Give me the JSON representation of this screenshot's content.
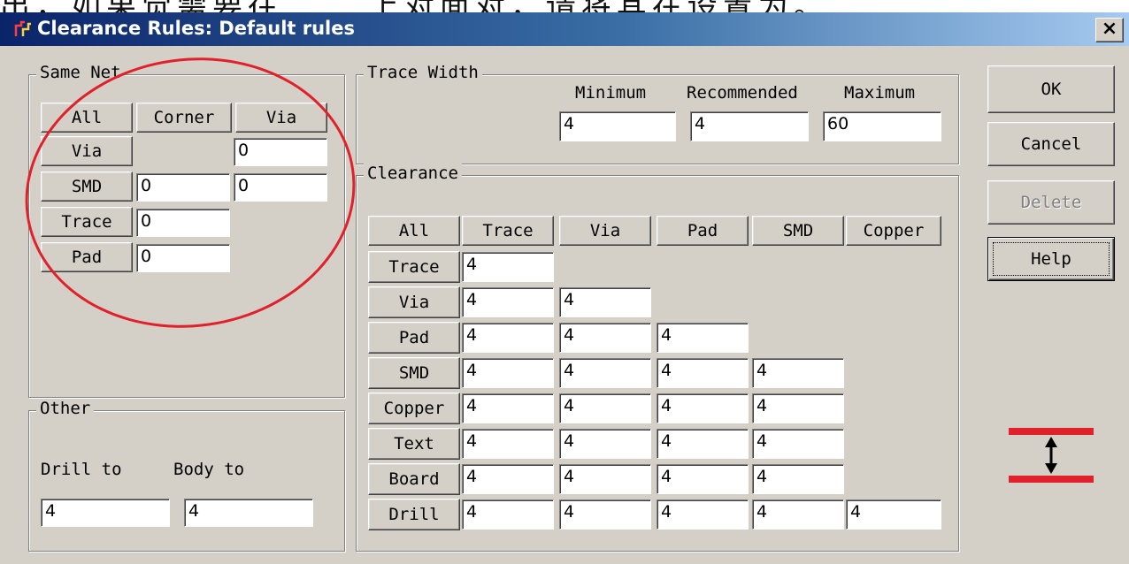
{
  "background_text": "出，如果觉需要往…… 上对面对，请将其在设置为。",
  "window": {
    "title": "Clearance Rules: Default rules",
    "close_label": "×"
  },
  "same_net": {
    "legend": "Same Net",
    "headers": [
      "All",
      "Corner",
      "Via"
    ],
    "rows": [
      {
        "label": "Via",
        "corner": "",
        "via": "0"
      },
      {
        "label": "SMD",
        "corner": "0",
        "via": "0"
      },
      {
        "label": "Trace",
        "corner": "0"
      },
      {
        "label": "Pad",
        "corner": "0"
      }
    ]
  },
  "other": {
    "legend": "Other",
    "drill_to_label": "Drill to",
    "body_to_label": "Body to",
    "drill_to_value": "4",
    "body_to_value": "4"
  },
  "trace_width": {
    "legend": "Trace Width",
    "minimum_label": "Minimum",
    "recommended_label": "Recommended",
    "maximum_label": "Maximum",
    "minimum": "4",
    "recommended": "4",
    "maximum": "60"
  },
  "clearance": {
    "legend": "Clearance",
    "headers": [
      "All",
      "Trace",
      "Via",
      "Pad",
      "SMD",
      "Copper"
    ],
    "rows": [
      {
        "label": "Trace",
        "values": [
          "4"
        ]
      },
      {
        "label": "Via",
        "values": [
          "4",
          "4"
        ]
      },
      {
        "label": "Pad",
        "values": [
          "4",
          "4",
          "4"
        ]
      },
      {
        "label": "SMD",
        "values": [
          "4",
          "4",
          "4",
          "4"
        ]
      },
      {
        "label": "Copper",
        "values": [
          "4",
          "4",
          "4",
          "4"
        ]
      },
      {
        "label": "Text",
        "values": [
          "4",
          "4",
          "4",
          "4"
        ]
      },
      {
        "label": "Board",
        "values": [
          "4",
          "4",
          "4",
          "4"
        ]
      },
      {
        "label": "Drill",
        "values": [
          "4",
          "4",
          "4",
          "4",
          "4"
        ]
      }
    ]
  },
  "buttons": {
    "ok": "OK",
    "cancel": "Cancel",
    "delete": "Delete",
    "help": "Help"
  },
  "colors": {
    "annotation_circle": "#e0202a",
    "titlebar_start": "#0a246a",
    "titlebar_end": "#a6caf0",
    "dialog_face": "#d4d0c8"
  },
  "icons": {
    "app": "pcb-trace-icon",
    "clearance_glyph": "clearance-arrow-icon"
  }
}
